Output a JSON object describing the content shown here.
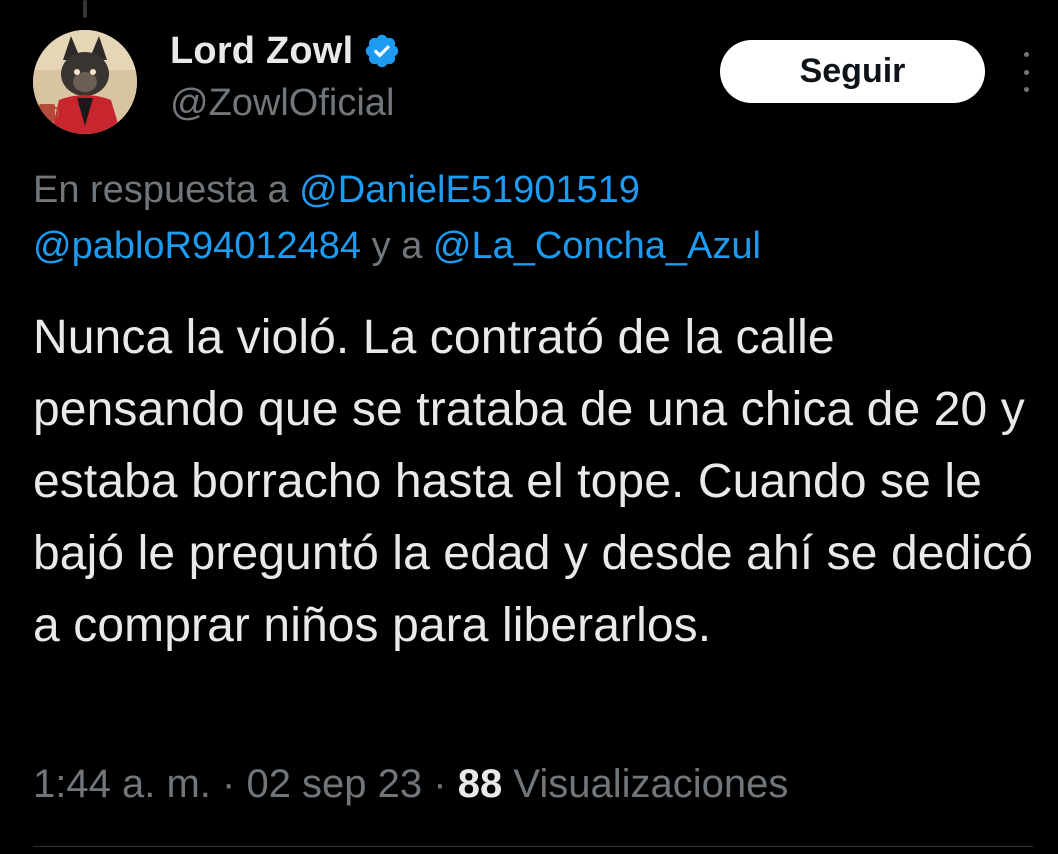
{
  "author": {
    "display_name": "Lord Zowl",
    "handle": "@ZowlOficial",
    "verified": true
  },
  "follow_button": {
    "label": "Seguir"
  },
  "reply_context": {
    "prefix": "En respuesta a",
    "mention_1": "@DanielE51901519",
    "mention_2": "@pabloR94012484",
    "connector": "y a",
    "mention_3": "@La_Concha_Azul"
  },
  "tweet": {
    "text": "Nunca la violó. La contrató de la calle pensando que se trataba de una chica de 20 y estaba borracho hasta el tope. Cuando se le bajó le preguntó la edad y desde ahí se dedicó a comprar niños para liberarlos."
  },
  "meta": {
    "time": "1:44 a. m.",
    "separator": "·",
    "date": "02 sep 23",
    "views_count": "88",
    "views_label": "Visualizaciones"
  },
  "colors": {
    "background": "#000000",
    "primary_text": "#e7e9ea",
    "secondary_text": "#71767b",
    "link": "#1d9bf0",
    "verified_badge": "#1d9bf0"
  },
  "icons": {
    "verified": "verified-badge-icon",
    "more": "more-options-icon"
  }
}
